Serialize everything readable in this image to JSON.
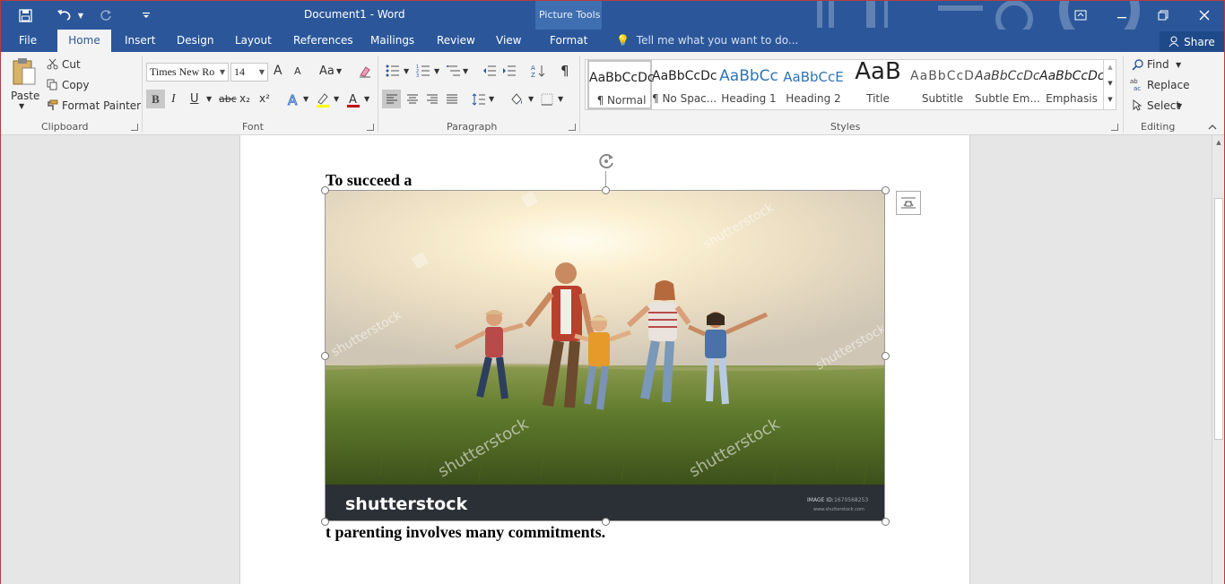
{
  "titlebar": {
    "document_title": "Document1 - Word",
    "contextual_group": "Picture Tools",
    "qat": {
      "save_icon": "save-icon",
      "undo_icon": "undo-icon",
      "redo_icon": "redo-icon",
      "customize_icon": "customize-qat-icon"
    }
  },
  "tabs": [
    {
      "label": "File"
    },
    {
      "label": "Home"
    },
    {
      "label": "Insert"
    },
    {
      "label": "Design"
    },
    {
      "label": "Layout"
    },
    {
      "label": "References"
    },
    {
      "label": "Mailings"
    },
    {
      "label": "Review"
    },
    {
      "label": "View"
    },
    {
      "label": "Format"
    }
  ],
  "tell_me": {
    "placeholder": "Tell me what you want to do..."
  },
  "share": {
    "label": "Share"
  },
  "clipboard": {
    "paste": "Paste",
    "cut": "Cut",
    "copy": "Copy",
    "format_painter": "Format Painter",
    "group": "Clipboard"
  },
  "font": {
    "name": "Times New Ro",
    "size": "14",
    "group": "Font",
    "bold": "B",
    "italic": "I",
    "underline": "U",
    "strike": "abc",
    "sub": "x₂",
    "sup": "x²",
    "grow": "A",
    "shrink": "A",
    "case": "Aa",
    "color_a": "A"
  },
  "paragraph": {
    "group": "Paragraph",
    "pilcrow": "¶"
  },
  "styles": {
    "group": "Styles",
    "items": [
      {
        "sample": "AaBbCcDc",
        "name": "¶ Normal"
      },
      {
        "sample": "AaBbCcDc",
        "name": "¶ No Spac..."
      },
      {
        "sample": "AaBbCc",
        "name": "Heading 1"
      },
      {
        "sample": "AaBbCcE",
        "name": "Heading 2"
      },
      {
        "sample": "AaB",
        "name": "Title"
      },
      {
        "sample": "AaBbCcD",
        "name": "Subtitle"
      },
      {
        "sample": "AaBbCcDc",
        "name": "Subtle Em..."
      },
      {
        "sample": "AaBbCcDc",
        "name": "Emphasis"
      }
    ],
    "colors": {
      "heading": "#2e74b5",
      "subtitle": "#595959"
    }
  },
  "editing": {
    "group": "Editing",
    "find": "Find",
    "replace": "Replace",
    "select": "Select"
  },
  "document": {
    "line1": "To succeed a",
    "line2": "t parenting involves many commitments."
  },
  "picture": {
    "watermark": "shutterstock",
    "watermark_small": "shutterstock",
    "image_id_label": "IMAGE ID:",
    "image_id": "1670568253",
    "site": "www.shutterstock.com"
  },
  "colors": {
    "brand": "#2b579a",
    "ribbon": "#f3f3f3",
    "canvas": "#e6e6e6"
  }
}
